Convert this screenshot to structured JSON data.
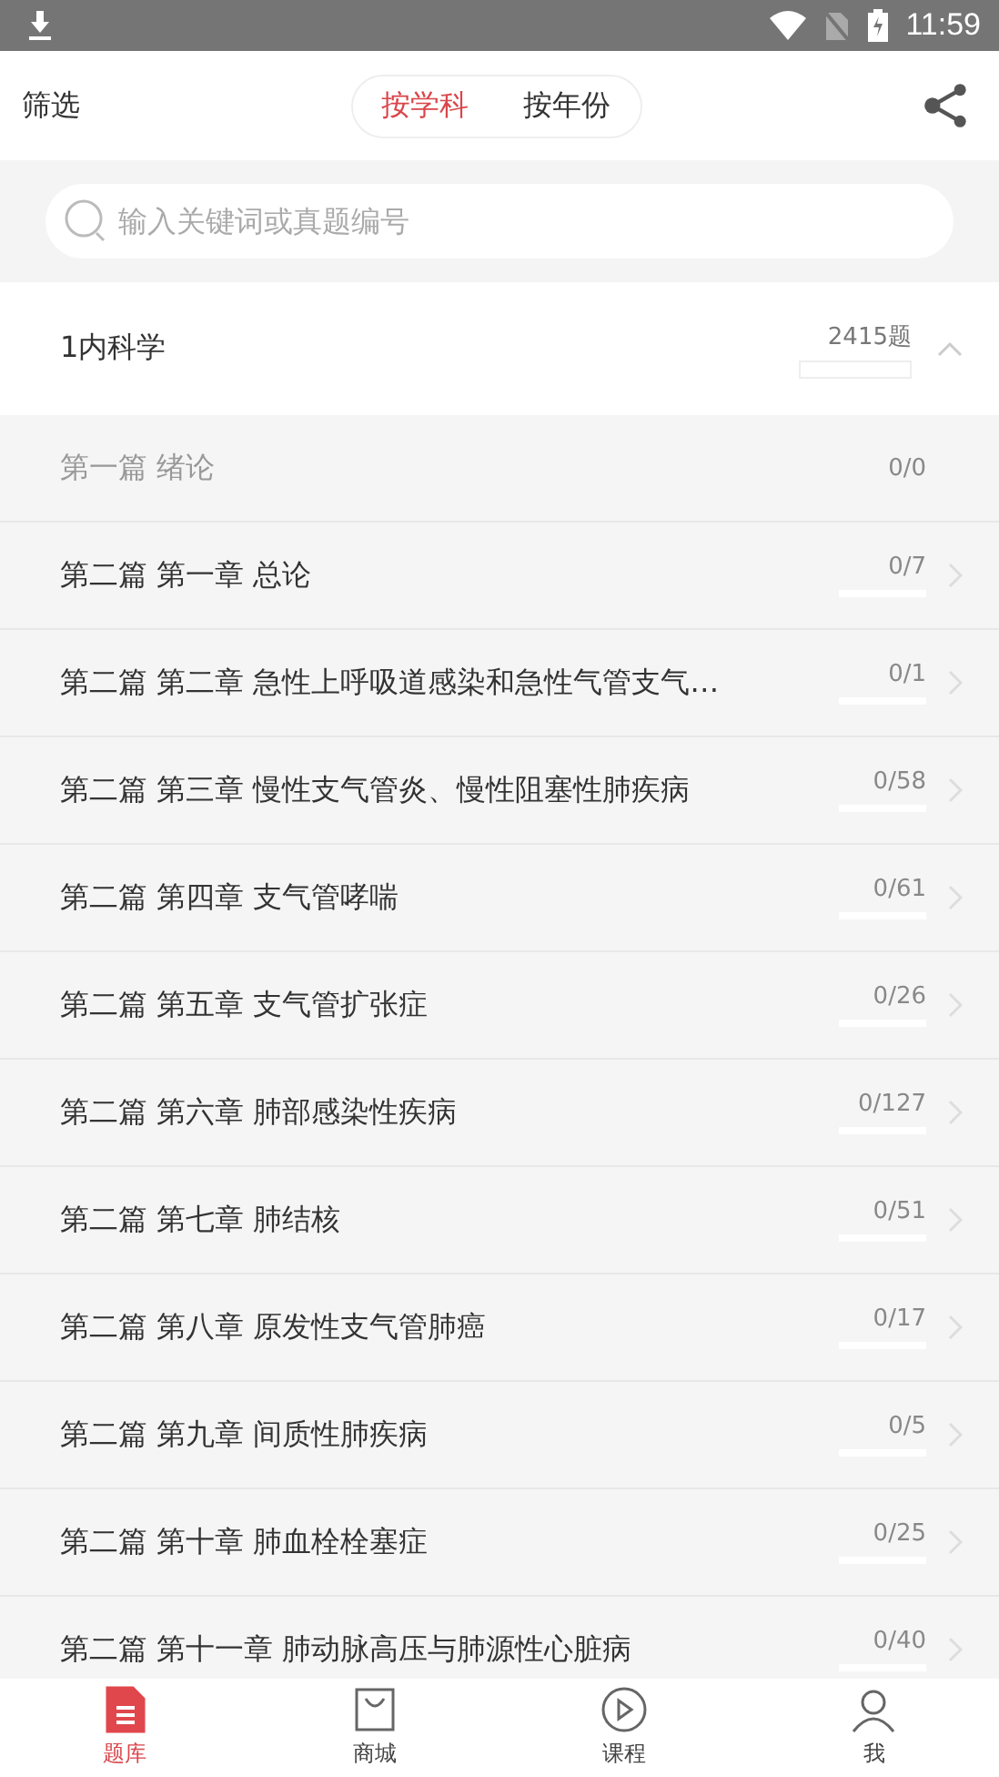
{
  "status_bar": {
    "time": "11:59"
  },
  "header": {
    "filter": "筛选",
    "tabs": [
      {
        "label": "按学科",
        "selected": true
      },
      {
        "label": "按年份",
        "selected": false
      }
    ]
  },
  "search": {
    "placeholder": "输入关键词或真题编号"
  },
  "subject": {
    "name": "1内科学",
    "count": "2415题",
    "level": 0,
    "expanded": true
  },
  "chapters": [
    {
      "title": "第一篇 绪论",
      "count": "0/0",
      "disabled": true
    },
    {
      "title": "第二篇 第一章 总论",
      "count": "0/7",
      "disabled": false,
      "level": 0
    },
    {
      "title": "第二篇 第二章 急性上呼吸道感染和急性气管支气…",
      "count": "0/1",
      "disabled": false,
      "level": 0
    },
    {
      "title": "第二篇 第三章 慢性支气管炎、慢性阻塞性肺疾病",
      "count": "0/58",
      "disabled": false,
      "level": 0
    },
    {
      "title": "第二篇 第四章 支气管哮喘",
      "count": "0/61",
      "disabled": false,
      "level": 0
    },
    {
      "title": "第二篇 第五章 支气管扩张症",
      "count": "0/26",
      "disabled": false,
      "level": 0
    },
    {
      "title": "第二篇 第六章 肺部感染性疾病",
      "count": "0/127",
      "disabled": false,
      "level": 0
    },
    {
      "title": "第二篇 第七章 肺结核",
      "count": "0/51",
      "disabled": false,
      "level": 0
    },
    {
      "title": "第二篇 第八章 原发性支气管肺癌",
      "count": "0/17",
      "disabled": false,
      "level": 0
    },
    {
      "title": "第二篇 第九章 间质性肺疾病",
      "count": "0/5",
      "disabled": false,
      "level": 0
    },
    {
      "title": "第二篇 第十章 肺血栓栓塞症",
      "count": "0/25",
      "disabled": false,
      "level": 0
    },
    {
      "title": "第二篇 第十一章 肺动脉高压与肺源性心脏病",
      "count": "0/40",
      "disabled": false,
      "level": 0
    }
  ],
  "nav": [
    {
      "label": "题库",
      "kind": "bank",
      "selected": true
    },
    {
      "label": "商城",
      "kind": "shop",
      "selected": false
    },
    {
      "label": "课程",
      "kind": "course",
      "selected": false
    },
    {
      "label": "我",
      "kind": "me",
      "selected": false
    }
  ]
}
